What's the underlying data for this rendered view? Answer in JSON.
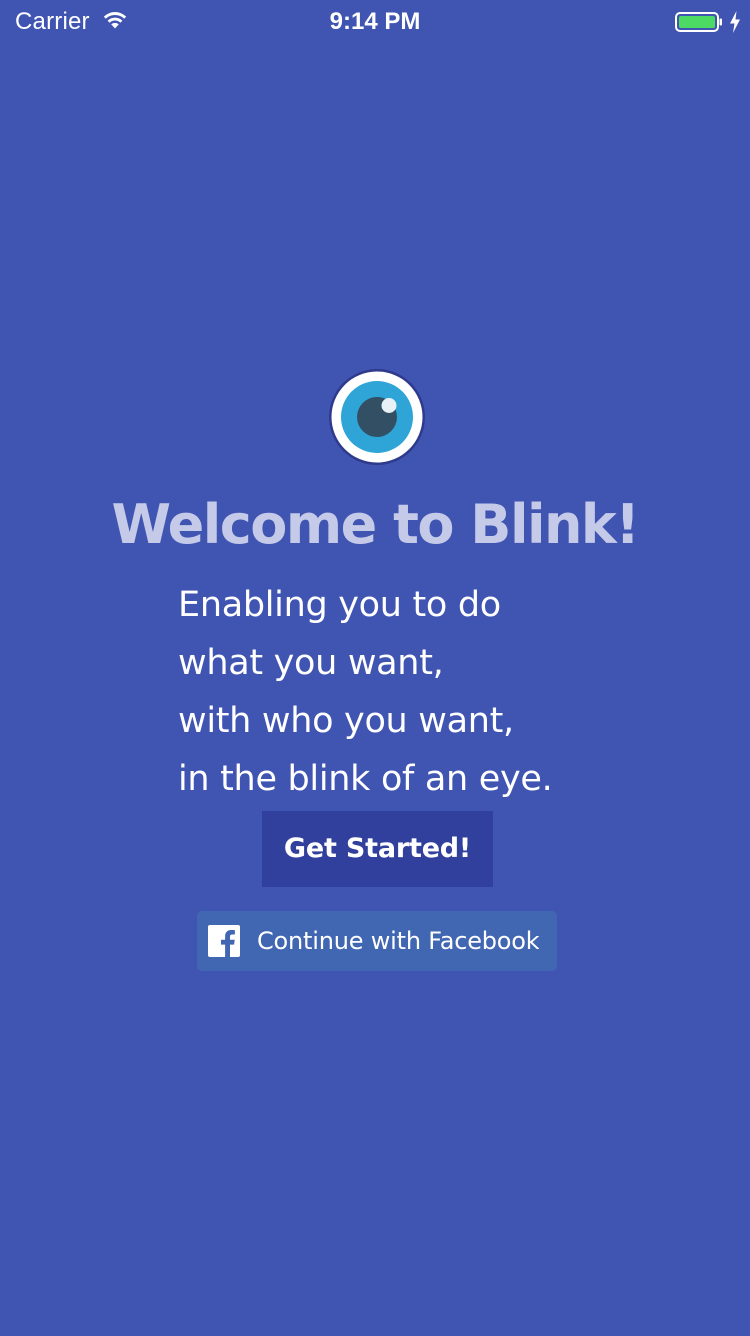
{
  "status_bar": {
    "carrier": "Carrier",
    "time": "9:14 PM",
    "icons": [
      "wifi-icon",
      "battery-icon",
      "charging-icon"
    ]
  },
  "welcome": {
    "logo_icon": "eye-icon",
    "title": "Welcome to Blink!",
    "tagline_lines": [
      "Enabling you to do",
      "what you want,",
      "with who you want,",
      "in the blink of an eye."
    ]
  },
  "actions": {
    "get_started_label": "Get Started!",
    "facebook_label": "Continue with Facebook",
    "facebook_icon": "facebook-icon"
  },
  "colors": {
    "background": "#4054b2",
    "title": "#c5cae9",
    "primary_button": "#30409c",
    "facebook_button": "#4267b2",
    "eye_iris": "#2fa4d6",
    "battery": "#4cd964"
  }
}
